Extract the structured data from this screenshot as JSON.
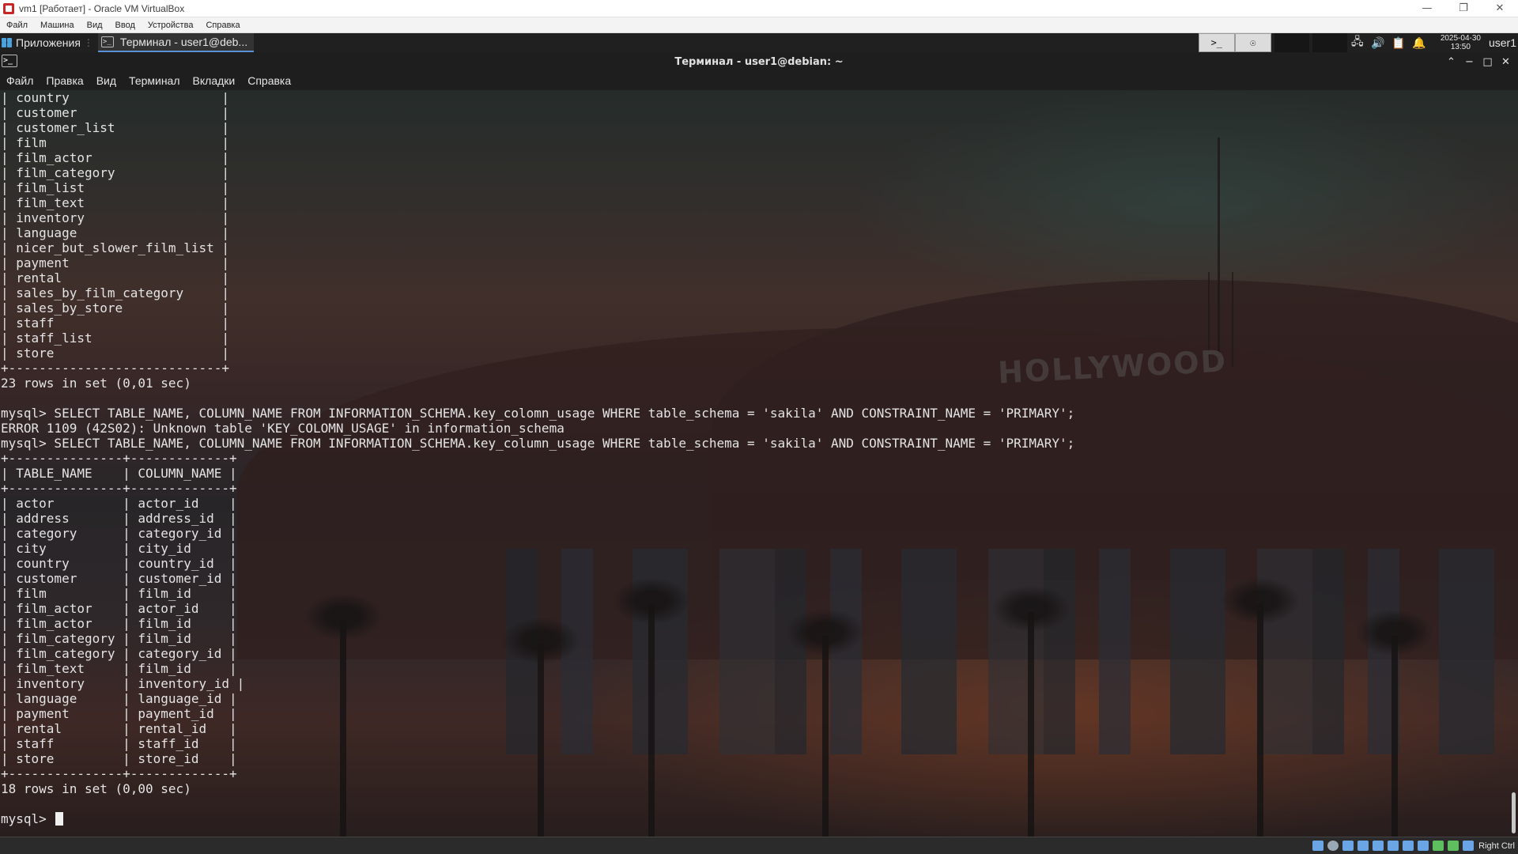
{
  "vbox": {
    "title": "vm1 [Работает] - Oracle VM VirtualBox",
    "menu": [
      "Файл",
      "Машина",
      "Вид",
      "Ввод",
      "Устройства",
      "Справка"
    ],
    "status_hostkey": "Right Ctrl"
  },
  "guest_panel": {
    "apps_label": "Приложения",
    "task_label": "Терминал - user1@deb...",
    "clock_date": "2025-04-30",
    "clock_time": "13:50",
    "user": "user1"
  },
  "terminal": {
    "title": "Терминал - user1@debian: ~",
    "menu": [
      "Файл",
      "Правка",
      "Вид",
      "Терминал",
      "Вкладки",
      "Справка"
    ],
    "lines": [
      "| country                    |",
      "| customer                   |",
      "| customer_list              |",
      "| film                       |",
      "| film_actor                 |",
      "| film_category              |",
      "| film_list                  |",
      "| film_text                  |",
      "| inventory                  |",
      "| language                   |",
      "| nicer_but_slower_film_list |",
      "| payment                    |",
      "| rental                     |",
      "| sales_by_film_category     |",
      "| sales_by_store             |",
      "| staff                      |",
      "| staff_list                 |",
      "| store                      |",
      "+----------------------------+",
      "23 rows in set (0,01 sec)",
      "",
      "mysql> SELECT TABLE_NAME, COLUMN_NAME FROM INFORMATION_SCHEMA.key_colomn_usage WHERE table_schema = 'sakila' AND CONSTRAINT_NAME = 'PRIMARY';",
      "ERROR 1109 (42S02): Unknown table 'KEY_COLOMN_USAGE' in information_schema",
      "mysql> SELECT TABLE_NAME, COLUMN_NAME FROM INFORMATION_SCHEMA.key_column_usage WHERE table_schema = 'sakila' AND CONSTRAINT_NAME = 'PRIMARY';",
      "+---------------+-------------+",
      "| TABLE_NAME    | COLUMN_NAME |",
      "+---------------+-------------+",
      "| actor         | actor_id    |",
      "| address       | address_id  |",
      "| category      | category_id |",
      "| city          | city_id     |",
      "| country       | country_id  |",
      "| customer      | customer_id |",
      "| film          | film_id     |",
      "| film_actor    | actor_id    |",
      "| film_actor    | film_id     |",
      "| film_category | film_id     |",
      "| film_category | category_id |",
      "| film_text     | film_id     |",
      "| inventory     | inventory_id |",
      "| language      | language_id |",
      "| payment       | payment_id  |",
      "| rental        | rental_id   |",
      "| staff         | staff_id    |",
      "| store         | store_id    |",
      "+---------------+-------------+",
      "18 rows in set (0,00 sec)",
      ""
    ],
    "prompt": "mysql> "
  }
}
